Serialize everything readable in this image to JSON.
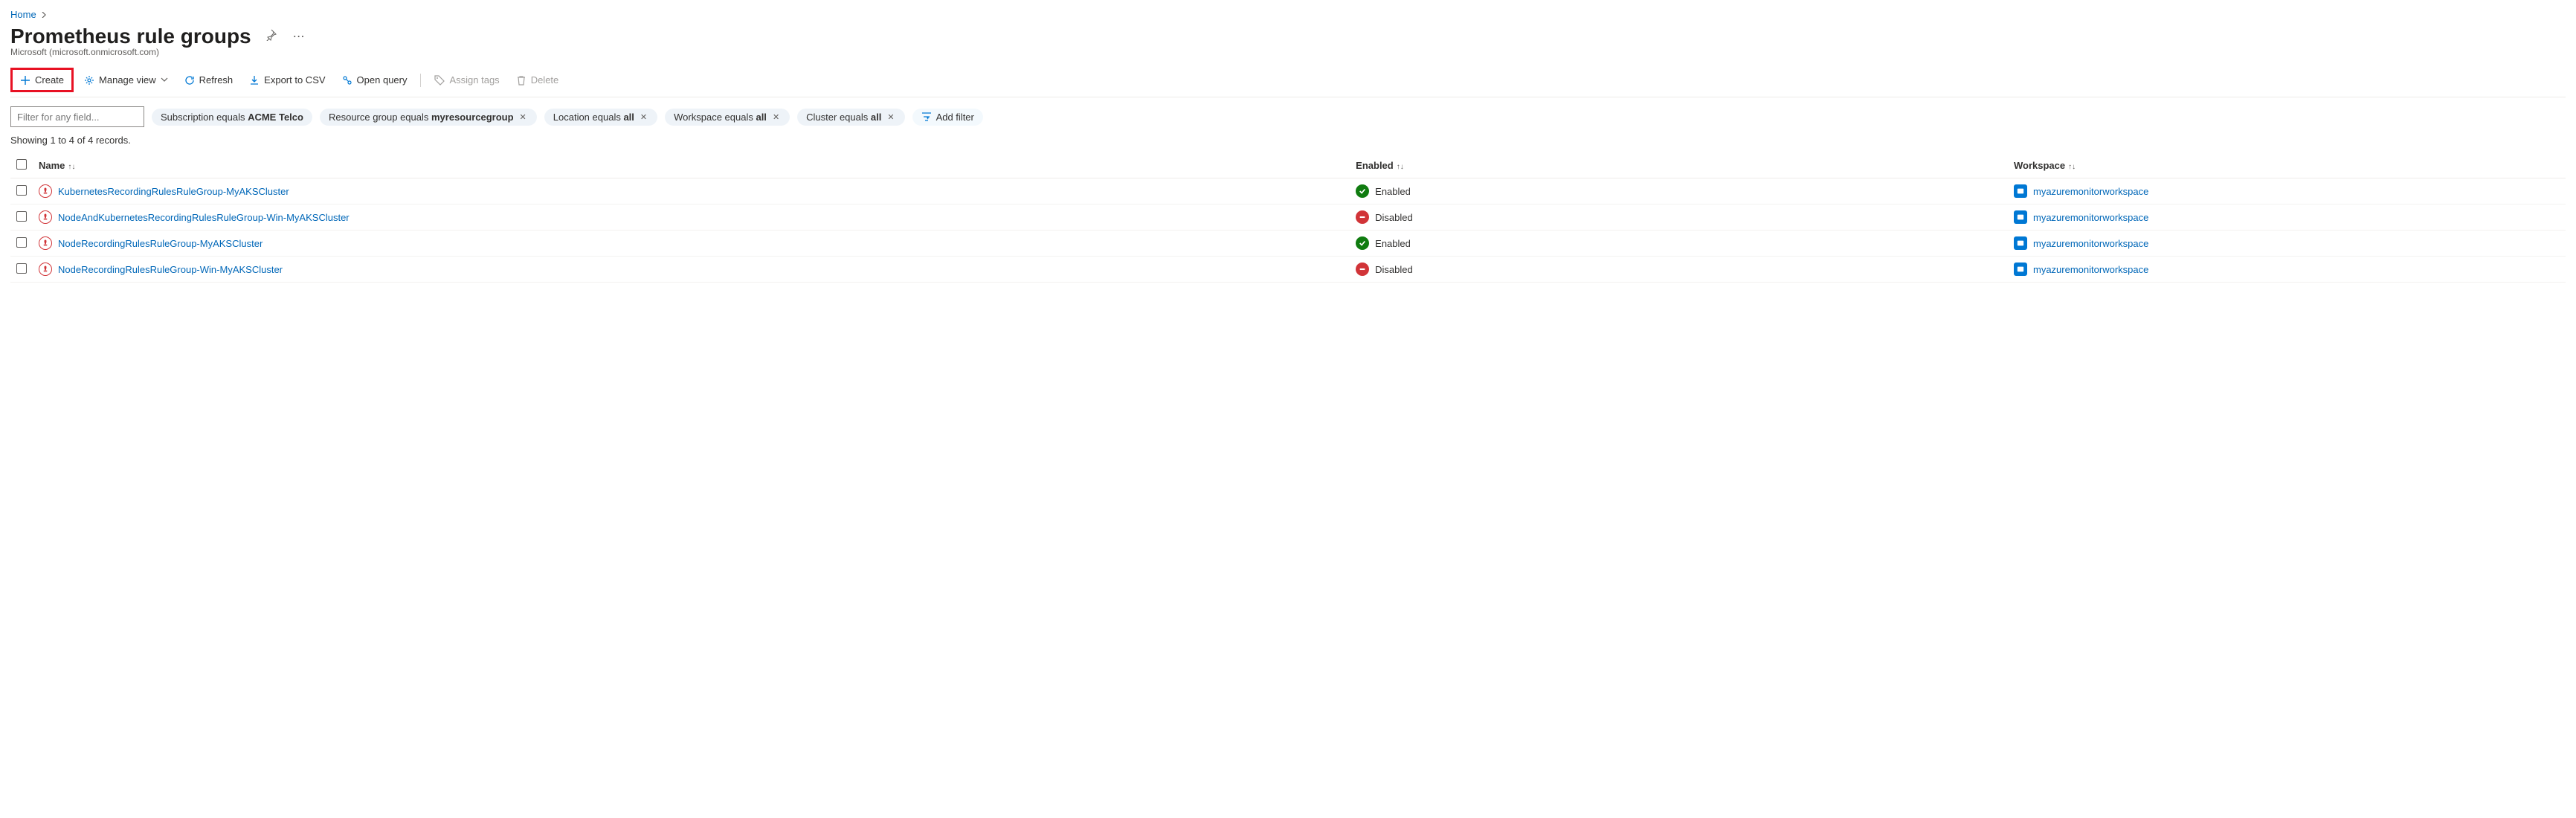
{
  "breadcrumb": {
    "home": "Home"
  },
  "header": {
    "title": "Prometheus rule groups",
    "subtitle": "Microsoft (microsoft.onmicrosoft.com)"
  },
  "toolbar": {
    "create": "Create",
    "manage_view": "Manage view",
    "refresh": "Refresh",
    "export_csv": "Export to CSV",
    "open_query": "Open query",
    "assign_tags": "Assign tags",
    "delete": "Delete"
  },
  "filters": {
    "input_placeholder": "Filter for any field...",
    "pills": [
      {
        "prefix": "Subscription equals ",
        "value": "ACME Telco",
        "closable": false
      },
      {
        "prefix": "Resource group equals ",
        "value": "myresourcegroup",
        "closable": true
      },
      {
        "prefix": "Location equals ",
        "value": "all",
        "closable": true
      },
      {
        "prefix": "Workspace equals ",
        "value": "all",
        "closable": true
      },
      {
        "prefix": "Cluster equals ",
        "value": "all",
        "closable": true
      }
    ],
    "add_filter": "Add filter"
  },
  "records_text": "Showing 1 to 4 of 4 records.",
  "table": {
    "columns": {
      "name": "Name",
      "enabled": "Enabled",
      "workspace": "Workspace"
    },
    "rows": [
      {
        "name": "KubernetesRecordingRulesRuleGroup-MyAKSCluster",
        "enabled": true,
        "enabled_text": "Enabled",
        "workspace": "myazuremonitorworkspace"
      },
      {
        "name": "NodeAndKubernetesRecordingRulesRuleGroup-Win-MyAKSCluster",
        "enabled": false,
        "enabled_text": "Disabled",
        "workspace": "myazuremonitorworkspace"
      },
      {
        "name": "NodeRecordingRulesRuleGroup-MyAKSCluster",
        "enabled": true,
        "enabled_text": "Enabled",
        "workspace": "myazuremonitorworkspace"
      },
      {
        "name": "NodeRecordingRulesRuleGroup-Win-MyAKSCluster",
        "enabled": false,
        "enabled_text": "Disabled",
        "workspace": "myazuremonitorworkspace"
      }
    ]
  }
}
